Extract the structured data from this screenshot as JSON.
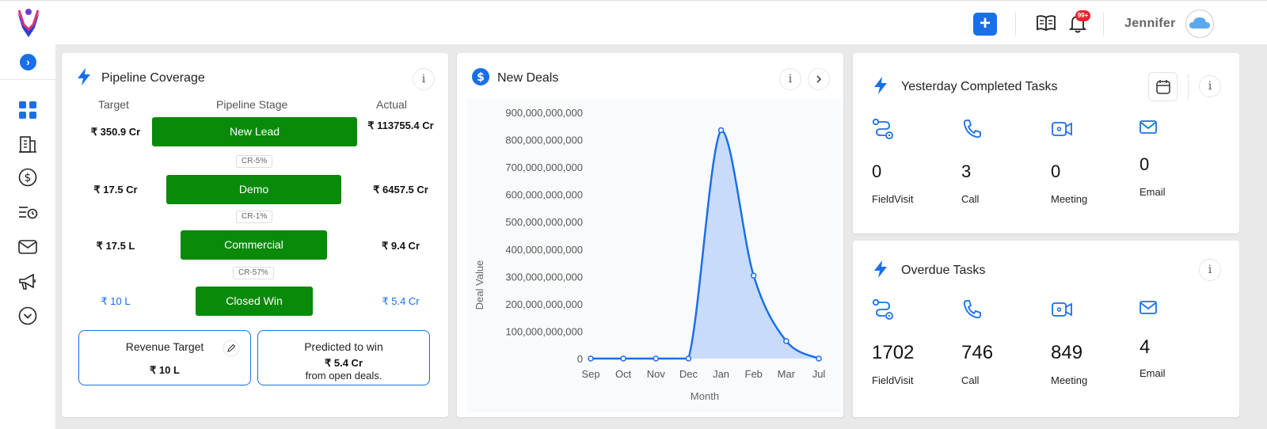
{
  "topbar": {
    "user_name": "Jennifer",
    "notification_badge": "99+",
    "add_label": "+"
  },
  "sidebar": {
    "expand_label": "›"
  },
  "pipeline": {
    "title": "Pipeline Coverage",
    "info": "i",
    "headers": {
      "target": "Target",
      "stage": "Pipeline Stage",
      "actual": "Actual"
    },
    "stages": [
      {
        "target": "₹ 350.9 Cr",
        "name": "New Lead",
        "actual": "₹ 113755.4 Cr"
      },
      {
        "target": "₹ 17.5 Cr",
        "name": "Demo",
        "actual": "₹ 6457.5 Cr"
      },
      {
        "target": "₹ 17.5 L",
        "name": "Commercial",
        "actual": "₹ 9.4 Cr"
      },
      {
        "target": "₹ 10 L",
        "name": "Closed Win",
        "actual": "₹ 5.4 Cr"
      }
    ],
    "conversions": [
      "CR-5%",
      "CR-1%",
      "CR-57%"
    ],
    "revenue_target": {
      "label": "Revenue Target",
      "value": "₹ 10 L"
    },
    "predicted": {
      "label": "Predicted to win",
      "value": "₹ 5.4 Cr",
      "note": "from open deals."
    }
  },
  "new_deals": {
    "title": "New Deals",
    "info": "i",
    "chart_data": {
      "type": "area",
      "title": "",
      "xlabel": "Month",
      "ylabel": "Deal Value",
      "x": [
        "Sep",
        "Oct",
        "Nov",
        "Dec",
        "Jan",
        "Feb",
        "Mar",
        "Jul"
      ],
      "series": [
        {
          "values": [
            0,
            0,
            0,
            0,
            835000000000,
            303000000000,
            64000000000,
            0
          ]
        }
      ],
      "ylim": [
        0,
        900000000000
      ],
      "yticks": [
        "0",
        "100,000,000,000",
        "200,000,000,000",
        "300,000,000,000",
        "400,000,000,000",
        "500,000,000,000",
        "600,000,000,000",
        "700,000,000,000",
        "800,000,000,000",
        "900,000,000,000"
      ],
      "grid": false,
      "colors": {
        "line": "#1a6fe8",
        "fill": "#c9dbfa"
      }
    }
  },
  "yesterday": {
    "title": "Yesterday Completed Tasks",
    "info": "i",
    "tasks": [
      {
        "label": "FieldVisit",
        "value": "0",
        "icon": "route-icon"
      },
      {
        "label": "Call",
        "value": "3",
        "icon": "phone-icon"
      },
      {
        "label": "Meeting",
        "value": "0",
        "icon": "video-icon"
      },
      {
        "label": "Email",
        "value": "0",
        "icon": "mail-icon"
      }
    ]
  },
  "overdue": {
    "title": "Overdue Tasks",
    "info": "i",
    "tasks": [
      {
        "label": "FieldVisit",
        "value": "1702",
        "icon": "route-icon"
      },
      {
        "label": "Call",
        "value": "746",
        "icon": "phone-icon"
      },
      {
        "label": "Meeting",
        "value": "849",
        "icon": "video-icon"
      },
      {
        "label": "Email",
        "value": "4",
        "icon": "mail-icon"
      }
    ]
  },
  "colors": {
    "accent": "#1a6fe8",
    "stage_green": "#0a8a0a",
    "badge_red": "#e8232d"
  }
}
